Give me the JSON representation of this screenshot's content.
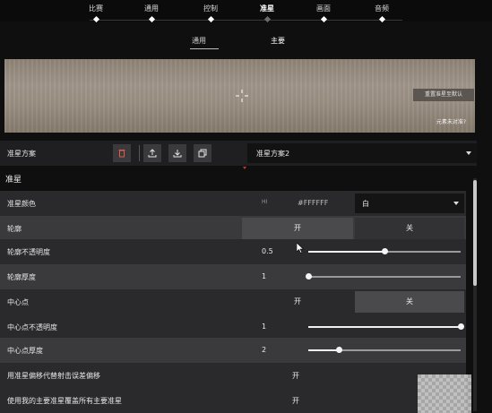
{
  "nav": {
    "tabs": [
      "比赛",
      "通用",
      "控制",
      "准星",
      "画面",
      "音频"
    ],
    "active_index": 3
  },
  "subnav": {
    "tabs": [
      "通用",
      "主要"
    ],
    "active_index": 1
  },
  "preview": {
    "reset_label": "重置准星至默认",
    "not_centered_label": "元素未对准?"
  },
  "profile": {
    "label": "准星方案",
    "selected": "准星方案2",
    "icons": [
      "delete-icon",
      "upload-icon",
      "download-icon",
      "copy-icon"
    ]
  },
  "section": {
    "title": "准星"
  },
  "rows": {
    "color": {
      "label": "准星颜色",
      "hex_prefix": "HI",
      "hex": "#FFFFFF",
      "selected": "白"
    },
    "outline": {
      "label": "轮廓",
      "on": "开",
      "off": "关",
      "index_marker": "1"
    },
    "outline_opacity": {
      "label": "轮廓不透明度",
      "value": "0.5",
      "fraction": 0.5
    },
    "outline_thickness": {
      "label": "轮廓厚度",
      "value": "1",
      "fraction": 0.0
    },
    "center_dot": {
      "label": "中心点",
      "on": "开",
      "off": "关"
    },
    "center_dot_opacity": {
      "label": "中心点不透明度",
      "value": "1",
      "fraction": 1.0
    },
    "center_dot_thickness": {
      "label": "中心点厚度",
      "value": "2",
      "fraction": 0.2
    },
    "firing_error_override": {
      "label": "用准星偏移代替射击误差偏移",
      "value": "开"
    },
    "override_all_primary": {
      "label": "使用我的主要准星覆盖所有主要准星",
      "value": "开"
    }
  },
  "colors": {
    "accent": "#ffffff",
    "selected_segment": "#4a4a4c",
    "unselected_segment": "#323234"
  }
}
